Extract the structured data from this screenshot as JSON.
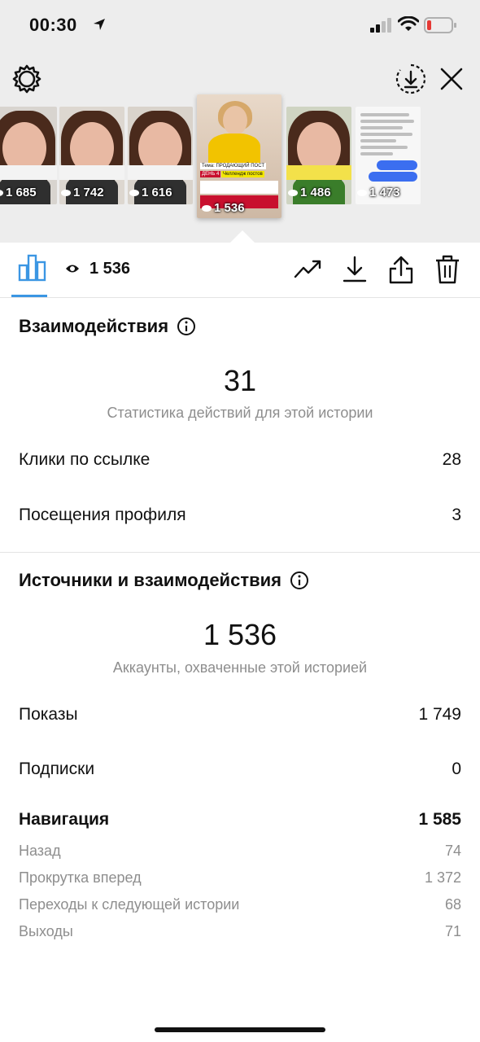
{
  "status_bar": {
    "time": "00:30"
  },
  "thumbnails": [
    {
      "views": "1 685",
      "style": "face"
    },
    {
      "views": "1 742",
      "style": "face"
    },
    {
      "views": "1 616",
      "style": "face"
    },
    {
      "views": "1 536",
      "style": "selected",
      "label_top": "Тема: ПРОДАЮЩИЙ ПОСТ",
      "label_day": "ДЕНЬ 4",
      "label_tag": "Челлендж постов"
    },
    {
      "views": "1 486",
      "style": "face"
    },
    {
      "views": "1 473",
      "style": "chat"
    }
  ],
  "toolbar": {
    "views_total": "1 536"
  },
  "interactions": {
    "title": "Взаимодействия",
    "total": "31",
    "subtitle": "Статистика действий для этой истории",
    "rows": [
      {
        "label": "Клики по ссылке",
        "value": "28"
      },
      {
        "label": "Посещения профиля",
        "value": "3"
      }
    ]
  },
  "discovery": {
    "title": "Источники и взаимодействия",
    "total": "1 536",
    "subtitle": "Аккаунты, охваченные этой историей",
    "impressions": {
      "label": "Показы",
      "value": "1 749"
    },
    "follows": {
      "label": "Подписки",
      "value": "0"
    },
    "navigation": {
      "label": "Навигация",
      "value": "1 585"
    },
    "nav_rows": [
      {
        "label": "Назад",
        "value": "74"
      },
      {
        "label": "Прокрутка вперед",
        "value": "1 372"
      },
      {
        "label": "Переходы к следующей истории",
        "value": "68"
      },
      {
        "label": "Выходы",
        "value": "71"
      }
    ]
  },
  "colors": {
    "accent": "#3b96e3",
    "top_background": "#ededed",
    "muted_text": "#8e8e8e",
    "battery_low": "#e53935"
  },
  "icons": [
    "location-arrow-icon",
    "signal-icon",
    "wifi-icon",
    "battery-icon",
    "gear-icon",
    "save-download-icon",
    "close-icon",
    "bar-chart-icon",
    "eye-icon",
    "trend-icon",
    "download-icon",
    "share-icon",
    "trash-icon",
    "info-icon"
  ]
}
